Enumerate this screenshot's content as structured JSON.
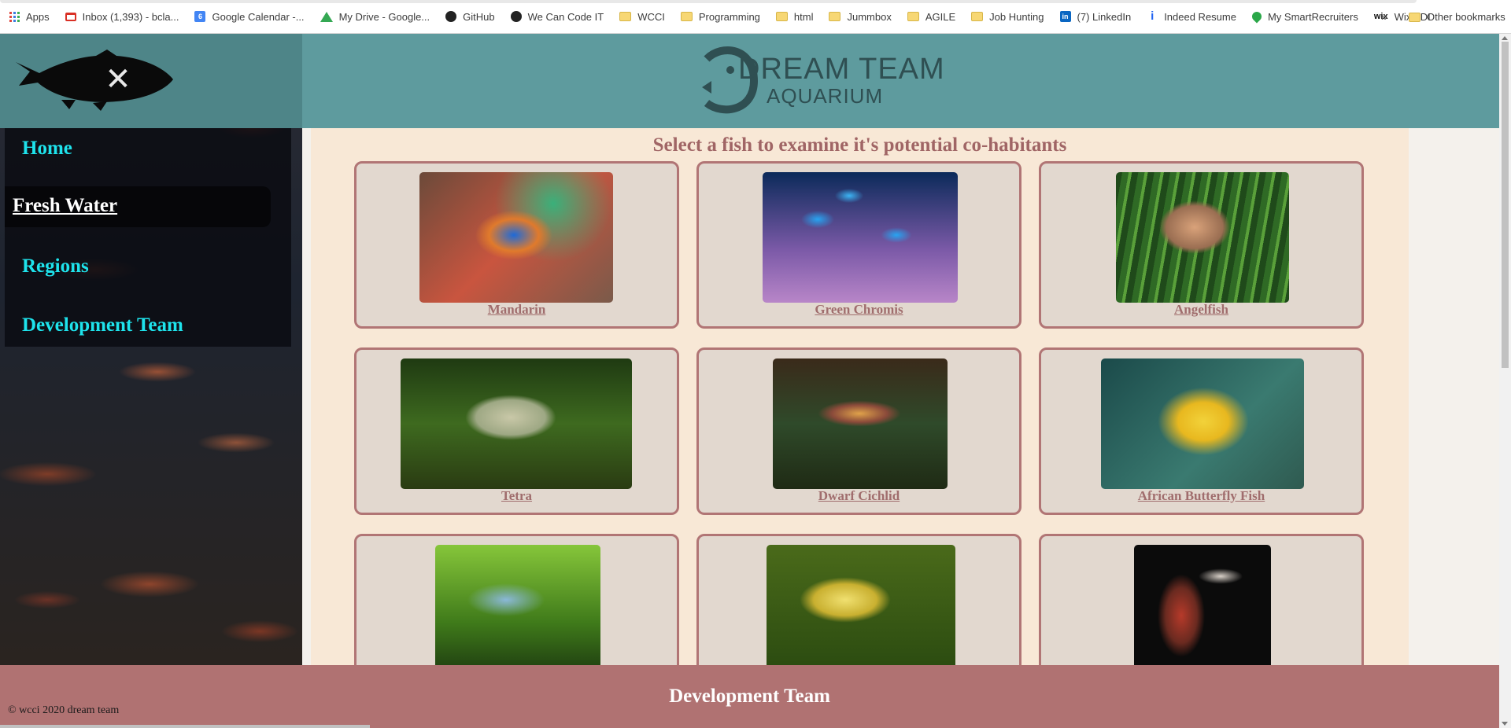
{
  "bookmarks": [
    {
      "label": "Apps",
      "icon": "apps-icon"
    },
    {
      "label": "Inbox (1,393) - bcla...",
      "icon": "gmail-icon"
    },
    {
      "label": "Google Calendar -...",
      "icon": "calendar-icon"
    },
    {
      "label": "My Drive - Google...",
      "icon": "drive-icon"
    },
    {
      "label": "GitHub",
      "icon": "github-icon"
    },
    {
      "label": "We Can Code IT",
      "icon": "github-icon"
    },
    {
      "label": "WCCI",
      "icon": "folder-icon"
    },
    {
      "label": "Programming",
      "icon": "folder-icon"
    },
    {
      "label": "html",
      "icon": "folder-icon"
    },
    {
      "label": "Jummbox",
      "icon": "folder-icon"
    },
    {
      "label": "AGILE",
      "icon": "folder-icon"
    },
    {
      "label": "Job Hunting",
      "icon": "folder-icon"
    },
    {
      "label": "(7) LinkedIn",
      "icon": "linkedin-icon"
    },
    {
      "label": "Indeed Resume",
      "icon": "indeed-icon"
    },
    {
      "label": "My SmartRecruiters",
      "icon": "smartrecruiters-icon"
    },
    {
      "label": "Wix ADI",
      "icon": "wix-icon"
    }
  ],
  "bookmarks_more": "»",
  "other_bookmarks": "Other bookmarks",
  "header": {
    "close_glyph": "✕",
    "brand_top": "DREAM TEAM",
    "brand_bottom": "AQUARIUM"
  },
  "nav": {
    "items": [
      "Home",
      "Fresh Water",
      "Regions",
      "Development Team"
    ],
    "active": "Fresh Water"
  },
  "content": {
    "title": "Select a fish to examine it's potential co-habitants",
    "fish": [
      {
        "name": "Mandarin"
      },
      {
        "name": "Green Chromis"
      },
      {
        "name": "Angelfish"
      },
      {
        "name": "Tetra"
      },
      {
        "name": "Dwarf Cichlid"
      },
      {
        "name": "African Butterfly Fish"
      },
      {
        "name": ""
      },
      {
        "name": ""
      },
      {
        "name": ""
      }
    ]
  },
  "footer": {
    "title": "Development Team",
    "copyright": "© wcci 2020 dream team"
  },
  "colors": {
    "header": "#5e9b9e",
    "nav_text": "#1ee3ec",
    "content_bg": "#f8e8d6",
    "card_border": "#b17575",
    "title_color": "#a06565",
    "footer": "#b07272"
  }
}
